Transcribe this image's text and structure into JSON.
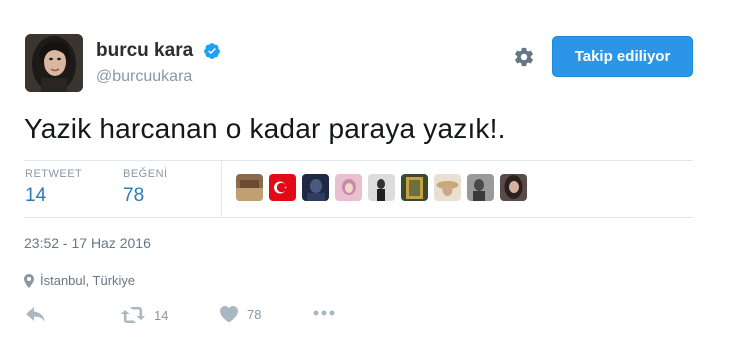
{
  "user": {
    "fullname": "burcu kara",
    "screenname": "@burcuukara",
    "verified": true
  },
  "follow_button": {
    "label": "Takip ediliyor"
  },
  "tweet": {
    "text": "Yazik harcanan o kadar paraya yazık!."
  },
  "stats": {
    "retweet_label": "RETWEET",
    "retweet_count": "14",
    "like_label": "BEĞENİ",
    "like_count": "78"
  },
  "likers": [
    {
      "name": "liker-avatar-1",
      "color": "#8a6a4a"
    },
    {
      "name": "liker-avatar-2-flag",
      "color": "#e30a17"
    },
    {
      "name": "liker-avatar-3",
      "color": "#2a3550"
    },
    {
      "name": "liker-avatar-4",
      "color": "#c98aa8"
    },
    {
      "name": "liker-avatar-5",
      "color": "#d8d8d8"
    },
    {
      "name": "liker-avatar-6",
      "color": "#9a8a40"
    },
    {
      "name": "liker-avatar-7",
      "color": "#c8b088"
    },
    {
      "name": "liker-avatar-8",
      "color": "#6a6a6a"
    },
    {
      "name": "liker-avatar-9",
      "color": "#5a4a48"
    }
  ],
  "timestamp": "23:52 - 17 Haz 2016",
  "location": "İstanbul, Türkiye",
  "actions": {
    "retweet_count": "14",
    "like_count": "78"
  },
  "colors": {
    "accent": "#2b96e8",
    "link": "#2b7bb9",
    "muted": "#8899a6"
  },
  "icons": [
    "verified-icon",
    "gear-icon",
    "location-pin-icon",
    "reply-icon",
    "retweet-icon",
    "heart-icon",
    "more-icon"
  ]
}
